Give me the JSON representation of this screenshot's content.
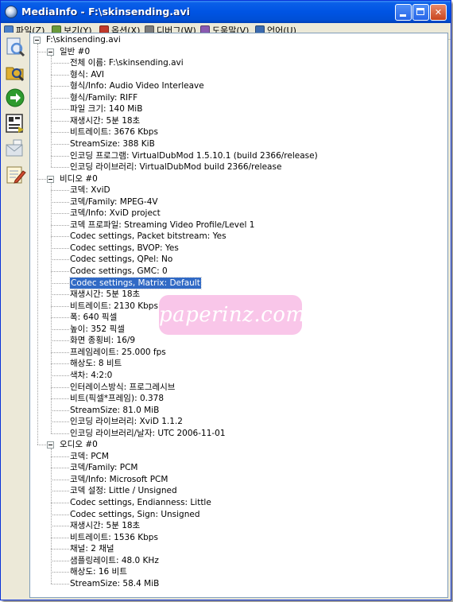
{
  "window": {
    "title": "MediaInfo - F:\\skinsending.avi"
  },
  "menu": [
    {
      "name": "file",
      "label": "파일(Z)",
      "icon": "file-icon",
      "color": "#4a7fc8"
    },
    {
      "name": "view",
      "label": "보기(Y)",
      "icon": "view-icon",
      "color": "#6a9a3c"
    },
    {
      "name": "options",
      "label": "옵션(X)",
      "icon": "options-icon",
      "color": "#c0392b"
    },
    {
      "name": "debug",
      "label": "디버그(W)",
      "icon": "debug-icon",
      "color": "#7a7a7a"
    },
    {
      "name": "help",
      "label": "도움말(V)",
      "icon": "help-icon",
      "color": "#8a5ab0"
    },
    {
      "name": "language",
      "label": "언어(U)",
      "icon": "language-icon",
      "color": "#3a6ab0"
    }
  ],
  "toolbar": [
    {
      "name": "open-file",
      "icon": "open-file-icon",
      "color": "#5a8fd8"
    },
    {
      "name": "open-folder",
      "icon": "open-folder-icon",
      "color": "#e0b030"
    },
    {
      "name": "go-forward",
      "icon": "go-forward-icon",
      "color": "#2e9a2e"
    },
    {
      "name": "export",
      "icon": "export-icon",
      "color": "#303030"
    },
    {
      "name": "email",
      "icon": "email-icon",
      "color": "#8a9aa8"
    },
    {
      "name": "notes",
      "icon": "notes-icon",
      "color": "#d04a30"
    }
  ],
  "tree": {
    "file": "F:\\skinsending.avi",
    "sections": [
      {
        "title": "일반 #0",
        "items": [
          "전체 이름: F:\\skinsending.avi",
          "형식: AVI",
          "형식/Info: Audio Video Interleave",
          "형식/Family: RIFF",
          "파일 크기: 140 MiB",
          "재생시간: 5분 18초",
          "비트레이트: 3676 Kbps",
          "StreamSize: 388 KiB",
          "인코딩 프로그램: VirtualDubMod 1.5.10.1 (build 2366/release)",
          "인코딩 라이브러리: VirtualDubMod build 2366/release"
        ]
      },
      {
        "title": "비디오 #0",
        "items": [
          "코덱: XviD",
          "코덱/Family: MPEG-4V",
          "코덱/Info: XviD project",
          "코덱 프로파일: Streaming Video Profile/Level 1",
          "Codec settings, Packet bitstream: Yes",
          "Codec settings, BVOP: Yes",
          "Codec settings, QPel: No",
          "Codec settings, GMC: 0",
          "Codec settings, Matrix: Default",
          "재생시간: 5분 18초",
          "비트레이트: 2130 Kbps",
          "폭: 640 픽셀",
          "높이: 352 픽셀",
          "화면 종횡비: 16/9",
          "프레임레이트: 25.000 fps",
          "해상도: 8 비트",
          "색차: 4:2:0",
          "인터레이스방식: 프로그레시브",
          "비트(픽셀*프레임): 0.378",
          "StreamSize: 81.0 MiB",
          "인코딩 라이브러리: XviD 1.1.2",
          "인코딩 라이브러리/날자: UTC 2006-11-01"
        ]
      },
      {
        "title": "오디오 #0",
        "items": [
          "코덱: PCM",
          "코덱/Family: PCM",
          "코덱/Info: Microsoft PCM",
          "코덱 설정: Little / Unsigned",
          "Codec settings, Endianness: Little",
          "Codec settings, Sign: Unsigned",
          "재생시간: 5분 18초",
          "비트레이트: 1536 Kbps",
          "채널: 2 채널",
          "샘플링레이트: 48.0 KHz",
          "해상도: 16 비트",
          "StreamSize: 58.4 MiB"
        ]
      }
    ],
    "selected": {
      "section": 1,
      "item": 8
    }
  },
  "watermark": "paperinz.com",
  "colors": {
    "title_bar": "#0054e3",
    "selection": "#316ac5",
    "watermark": "#f9c2e8"
  }
}
